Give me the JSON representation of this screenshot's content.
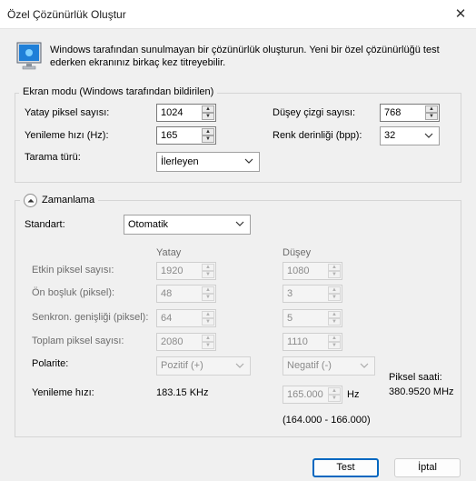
{
  "window": {
    "title": "Özel Çözünürlük Oluştur"
  },
  "intro": {
    "text": "Windows tarafından sunulmayan bir çözünürlük oluşturun. Yeni bir özel çözünürlüğü test ederken ekranınız birkaç kez titreyebilir."
  },
  "display_mode": {
    "title": "Ekran modu (Windows tarafından bildirilen)",
    "h_pixels_label": "Yatay piksel sayısı:",
    "h_pixels_value": "1024",
    "v_lines_label": "Düşey çizgi sayısı:",
    "v_lines_value": "768",
    "refresh_label": "Yenileme hızı (Hz):",
    "refresh_value": "165",
    "color_depth_label": "Renk derinliği (bpp):",
    "color_depth_value": "32",
    "scan_label": "Tarama türü:",
    "scan_value": "İlerleyen"
  },
  "timing": {
    "title": "Zamanlama",
    "standard_label": "Standart:",
    "standard_value": "Otomatik",
    "col_horizontal": "Yatay",
    "col_vertical": "Düşey",
    "rows": [
      {
        "label": "Etkin piksel sayısı:",
        "h": "1920",
        "v": "1080"
      },
      {
        "label": "Ön boşluk (piksel):",
        "h": "48",
        "v": "3"
      },
      {
        "label": "Senkron. genişliği (piksel):",
        "h": "64",
        "v": "5"
      },
      {
        "label": "Toplam piksel sayısı:",
        "h": "2080",
        "v": "1110"
      }
    ],
    "polarity_label": "Polarite:",
    "polarity_h": "Pozitif (+)",
    "polarity_v": "Negatif (-)",
    "refresh_label": "Yenileme hızı:",
    "refresh_h": "183.15 KHz",
    "refresh_v": "165.000",
    "refresh_unit": "Hz",
    "refresh_range": "(164.000 - 166.000)",
    "pixel_clock_label": "Piksel saati:",
    "pixel_clock_value": "380.9520 MHz"
  },
  "buttons": {
    "test": "Test",
    "cancel": "İptal"
  }
}
